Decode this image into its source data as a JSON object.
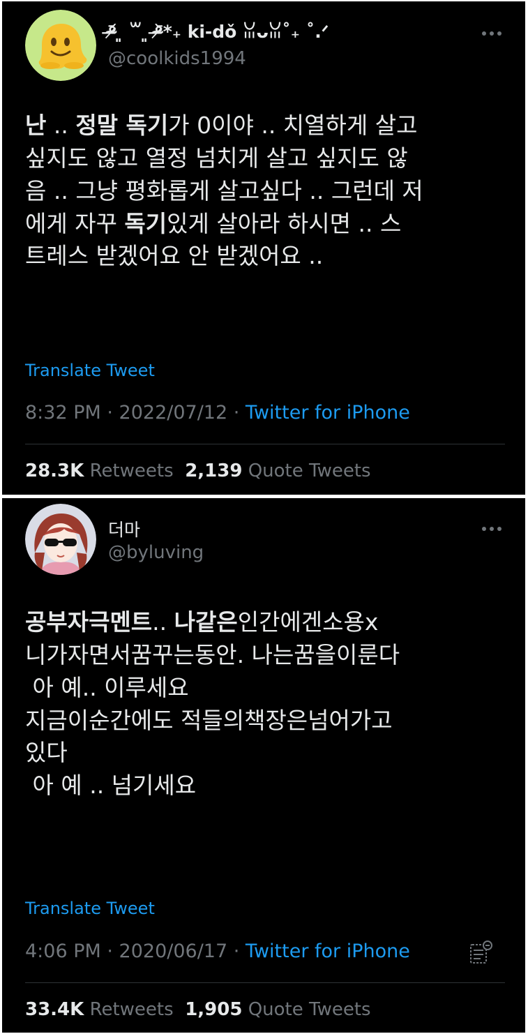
{
  "tweets": [
    {
      "display_name": "ᵒ̴̶̷᷄ ͈ ꒳ ͈ ᵒ̴̶̷᷅*₊ ki-dǒ ꈍᴗꈍ˚₊ ˚.ᐟ",
      "handle": "@coolkids1994",
      "avatar_icon": "melting-face-emoji",
      "body_lines": [
        [
          {
            "t": "난",
            "b": true
          },
          {
            "t": " .. "
          },
          {
            "t": "정말 독기",
            "b": true
          },
          {
            "t": "가 0이야 .. 치열하게 살고"
          }
        ],
        [
          {
            "t": "싶지도 않고 열정 넘치게 살고 싶지도 않"
          }
        ],
        [
          {
            "t": "음 .. 그냥 평화롭게 살고싶다 .. 그런데 저"
          }
        ],
        [
          {
            "t": "에게 자꾸 "
          },
          {
            "t": "독기",
            "b": true
          },
          {
            "t": "있게 살아라 하시면 .. 스"
          }
        ],
        [
          {
            "t": "트레스 받겠어요 안 받겠어요 .."
          }
        ]
      ],
      "translate_label": "Translate Tweet",
      "time": "8:32 PM",
      "date": "2022/07/12",
      "separator": " · ",
      "source": "Twitter for iPhone",
      "retweets_count": "28.3K",
      "retweets_label": "Retweets",
      "quotes_count": "2,139",
      "quotes_label": "Quote Tweets"
    },
    {
      "display_name": "더마",
      "handle": "@byluving",
      "avatar_icon": "anime-girl-sunglasses-avatar",
      "body_lines": [
        [
          {
            "t": "공부자극멘트",
            "b": true
          },
          {
            "t": ".. "
          },
          {
            "t": "나같은",
            "b": true
          },
          {
            "t": "인간에겐소용x"
          }
        ],
        [
          {
            "t": "니가자면서꿈꾸는동안. 나는꿈을이룬다"
          }
        ],
        [
          {
            "t": " 아 예.. 이루세요"
          }
        ],
        [
          {
            "t": "지금이순간에도 적들의책장은넘어가고"
          }
        ],
        [
          {
            "t": "있다"
          }
        ],
        [
          {
            "t": " 아 예 .. 넘기세요"
          }
        ]
      ],
      "translate_label": "Translate Tweet",
      "time": "4:06 PM",
      "date": "2020/06/17",
      "separator": " · ",
      "source": "Twitter for iPhone",
      "retweets_count": "33.4K",
      "retweets_label": "Retweets",
      "quotes_count": "1,905",
      "quotes_label": "Quote Tweets"
    }
  ],
  "colors": {
    "background": "#000000",
    "text": "#e7e9ea",
    "secondary": "#71767b",
    "link": "#1d9bf0",
    "divider": "#2f3336"
  }
}
